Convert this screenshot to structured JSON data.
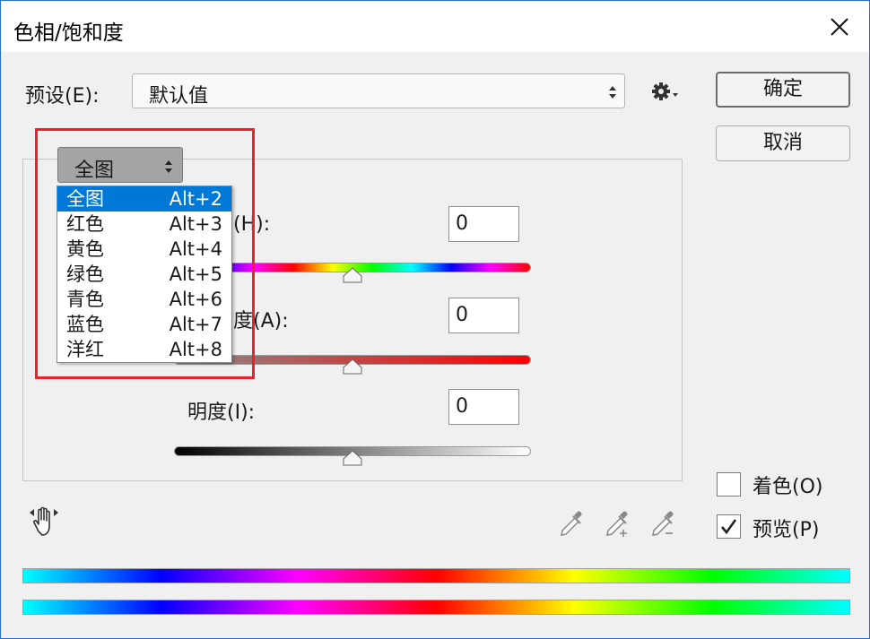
{
  "window": {
    "title": "色相/饱和度"
  },
  "preset": {
    "label": "预设(E):",
    "value": "默认值"
  },
  "buttons": {
    "ok": "确定",
    "cancel": "取消"
  },
  "channel": {
    "value": "全图",
    "menu": [
      {
        "label": "全图",
        "shortcut": "Alt+2",
        "selected": true
      },
      {
        "label": "红色",
        "shortcut": "Alt+3"
      },
      {
        "label": "黄色",
        "shortcut": "Alt+4"
      },
      {
        "label": "绿色",
        "shortcut": "Alt+5"
      },
      {
        "label": "青色",
        "shortcut": "Alt+6"
      },
      {
        "label": "蓝色",
        "shortcut": "Alt+7"
      },
      {
        "label": "洋红",
        "shortcut": "Alt+8"
      }
    ]
  },
  "adjustments": {
    "hue": {
      "label_partial": "(H):",
      "value": "0"
    },
    "saturation": {
      "label_partial": "度(A):",
      "value": "0"
    },
    "lightness": {
      "label": "明度(I):",
      "value": "0"
    }
  },
  "options": {
    "colorize": {
      "label": "着色(O)",
      "checked": false
    },
    "preview": {
      "label": "预览(P)",
      "checked": true
    }
  },
  "icons": {
    "close": "close-icon",
    "settings": "gear-icon",
    "hand": "hand-adjust-icon",
    "eyedropper": "eyedropper-icon",
    "eyedropper_add": "eyedropper-plus-icon",
    "eyedropper_sub": "eyedropper-minus-icon"
  },
  "colors": {
    "highlight": "#0078d7",
    "annotation_box": "#e8232a",
    "window_border": "#2b6dd1"
  }
}
